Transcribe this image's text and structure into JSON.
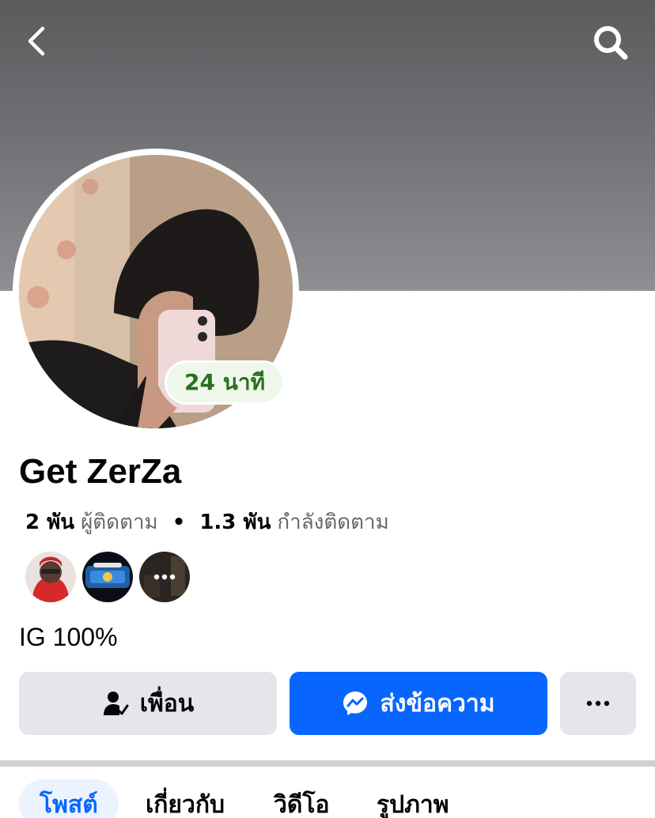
{
  "header": {
    "back_icon": "chevron-left-icon",
    "search_icon": "search-icon",
    "cover_color": "#6f7073"
  },
  "profile": {
    "name": "Get ZerZa",
    "active_badge": "24 นาที",
    "followers_count": "2 พัน",
    "followers_label": "ผู้ติดตาม",
    "separator": "•",
    "following_count": "1.3 พัน",
    "following_label": "กำลังติดตาม",
    "bio": "IG 100%"
  },
  "mutual_friends": {
    "more_label": "···"
  },
  "actions": {
    "friend_label": "เพื่อน",
    "friend_icon": "person-check-icon",
    "message_label": "ส่งข้อความ",
    "message_icon": "messenger-icon",
    "more_label": "···",
    "accent_color": "#0866ff"
  },
  "tabs": [
    {
      "label": "โพสต์",
      "active": true
    },
    {
      "label": "เกี่ยวกับ",
      "active": false
    },
    {
      "label": "วิดีโอ",
      "active": false
    },
    {
      "label": "รูปภาพ",
      "active": false
    }
  ]
}
